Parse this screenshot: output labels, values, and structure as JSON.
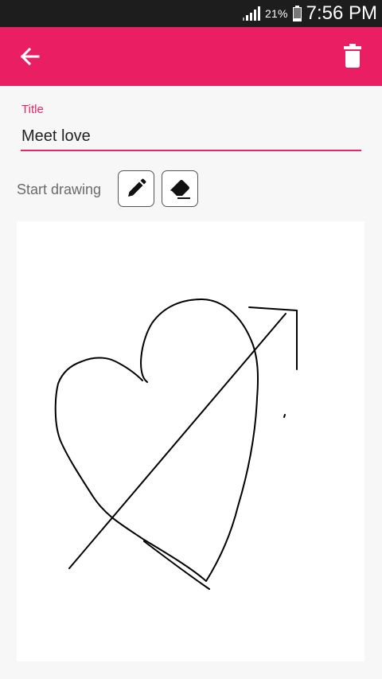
{
  "status_bar": {
    "signal_icon": "signal-bars-icon",
    "battery_percent": "21%",
    "battery_level": 0.21,
    "battery_icon": "battery-icon",
    "time": "7:56 PM"
  },
  "app_bar": {
    "back_icon": "arrow-left-icon",
    "delete_icon": "trash-icon",
    "color": "#ea1e63"
  },
  "form": {
    "title_label": "Title",
    "title_value": "Meet love",
    "start_drawing_label": "Start drawing",
    "pencil_icon": "pencil-icon",
    "eraser_icon": "eraser-icon",
    "accent_color": "#e0286a"
  },
  "drawing": {
    "strokes": "heart-with-arrow sketch",
    "stroke_color": "#000000"
  }
}
